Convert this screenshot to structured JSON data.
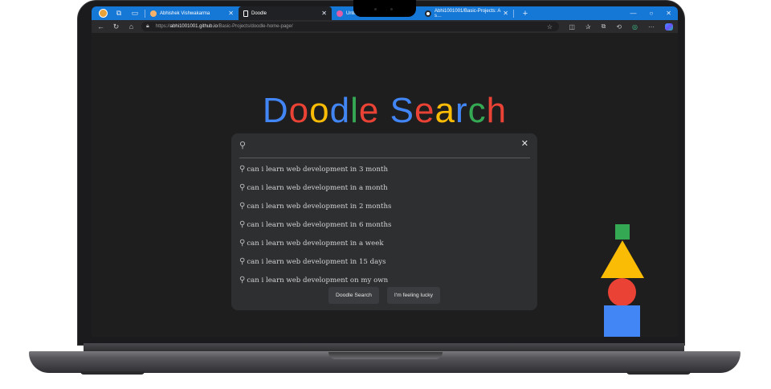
{
  "browser": {
    "tabs": [
      {
        "label": "Abhishek Vishwakarma",
        "favicon_color": "#f6b26b",
        "active": false
      },
      {
        "label": "Doodle",
        "favicon_color": "#ffffff",
        "active": true
      },
      {
        "label": "Untitled",
        "favicon_color": "#e05fa7",
        "active": false
      },
      {
        "label": "Abhi1001001/Basic-Projects: A s…",
        "favicon_color": "#24292f",
        "active": false
      }
    ],
    "new_tab_glyph": "+",
    "address": {
      "scheme": "https://",
      "host": "abhi1001001.github.io",
      "path": "/Basic-Projects/doodle-home-page/"
    }
  },
  "page": {
    "logo_letters": [
      {
        "ch": "D",
        "color": "#4285f4"
      },
      {
        "ch": "o",
        "color": "#ea4335"
      },
      {
        "ch": "o",
        "color": "#fbbc05"
      },
      {
        "ch": "d",
        "color": "#4285f4"
      },
      {
        "ch": "l",
        "color": "#34a853"
      },
      {
        "ch": "e",
        "color": "#ea4335"
      },
      {
        "ch": " ",
        "color": "#ffffff"
      },
      {
        "ch": "S",
        "color": "#4285f4"
      },
      {
        "ch": "e",
        "color": "#ea4335"
      },
      {
        "ch": "a",
        "color": "#fbbc05"
      },
      {
        "ch": "r",
        "color": "#4285f4"
      },
      {
        "ch": "c",
        "color": "#34a853"
      },
      {
        "ch": "h",
        "color": "#ea4335"
      }
    ],
    "search": {
      "value": "",
      "clear_glyph": "✕",
      "suggestions": [
        "can i learn web development in 3 month",
        "can i learn web development in a month",
        "can i learn web development in 2 months",
        "can i learn web development in 6 months",
        "can i learn web development in a week",
        "can i learn web development in 15 days",
        "can i learn web development on my own"
      ]
    },
    "buttons": {
      "search_label": "Doodle Search",
      "lucky_label": "I'm feeling lucky"
    },
    "shape_colors": {
      "green": "#34a853",
      "yellow": "#fbbc05",
      "red": "#ea4335",
      "blue": "#4285f4"
    }
  }
}
